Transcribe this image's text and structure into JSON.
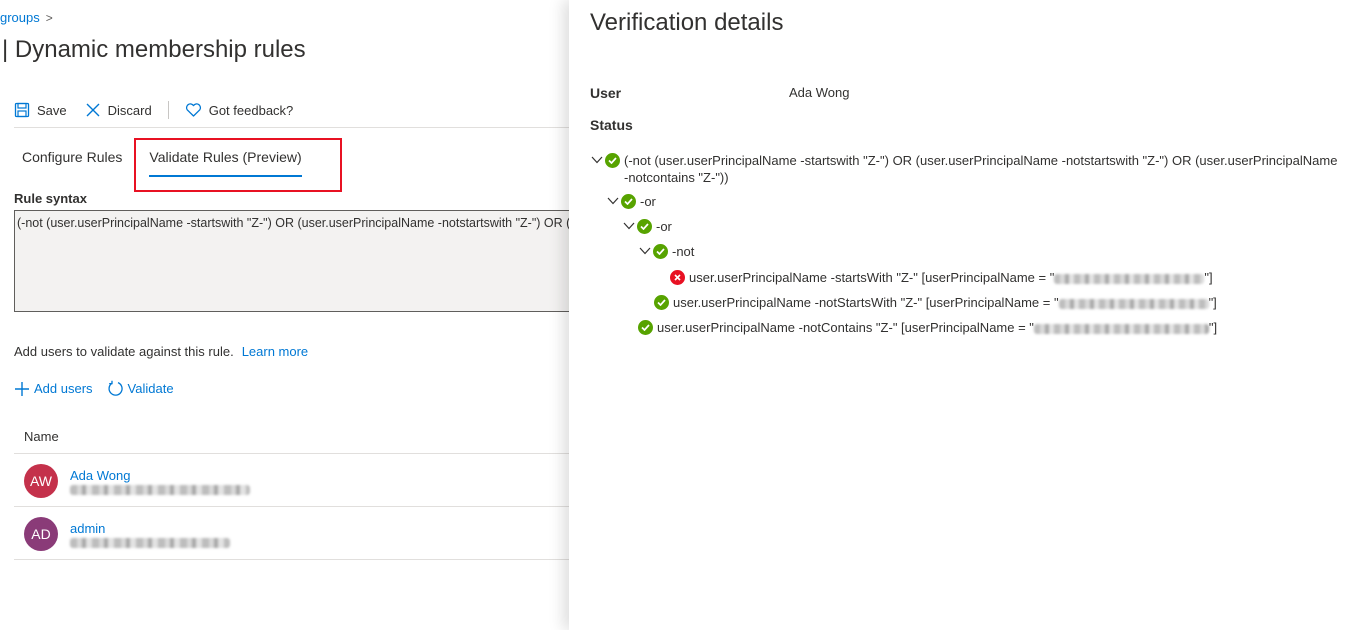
{
  "breadcrumb": {
    "item": "groups",
    "separator": ">"
  },
  "page": {
    "title": "| Dynamic membership rules"
  },
  "toolbar": {
    "save_label": "Save",
    "discard_label": "Discard",
    "feedback_label": "Got feedback?"
  },
  "tabs": [
    {
      "label": "Configure Rules",
      "active": false
    },
    {
      "label": "Validate Rules (Preview)",
      "active": true
    }
  ],
  "rule_syntax": {
    "label": "Rule syntax",
    "value": "(-not (user.userPrincipalName -startswith \"Z-\") OR (user.userPrincipalName -notstartswith \"Z-\") OR (user.userPrincipalName -notcontains \"Z-\"))"
  },
  "validate_hint": {
    "text": "Add users to validate against this rule.",
    "link": "Learn more"
  },
  "actions": {
    "add_users": "Add users",
    "validate": "Validate"
  },
  "users_table": {
    "header": "Name",
    "rows": [
      {
        "initials": "AW",
        "name": "Ada Wong",
        "avatar_color": "#c4314b"
      },
      {
        "initials": "AD",
        "name": "admin",
        "avatar_color": "#8a3b78"
      }
    ]
  },
  "verification": {
    "title": "Verification details",
    "user_label": "User",
    "user_value": "Ada Wong",
    "status_label": "Status",
    "tree": [
      {
        "text": "(-not (user.userPrincipalName -startswith \"Z-\") OR (user.userPrincipalName -notstartswith \"Z-\") OR (user.userPrincipalName -notcontains \"Z-\"))",
        "status": "pass"
      },
      {
        "text": "-or",
        "status": "pass"
      },
      {
        "text": "-or",
        "status": "pass"
      },
      {
        "text": "-not",
        "status": "pass"
      },
      {
        "text": "user.userPrincipalName -startsWith \"Z-\" [userPrincipalName = \"",
        "suffix": "\"]",
        "status": "fail"
      },
      {
        "text": "user.userPrincipalName -notStartsWith \"Z-\" [userPrincipalName = \"",
        "suffix": "\"]",
        "status": "pass"
      },
      {
        "text": "user.userPrincipalName -notContains \"Z-\" [userPrincipalName = \"",
        "suffix": "\"]",
        "status": "pass"
      }
    ]
  },
  "colors": {
    "accent": "#0078d4",
    "pass": "#57a300",
    "fail": "#e81123",
    "highlight": "#e81123"
  }
}
